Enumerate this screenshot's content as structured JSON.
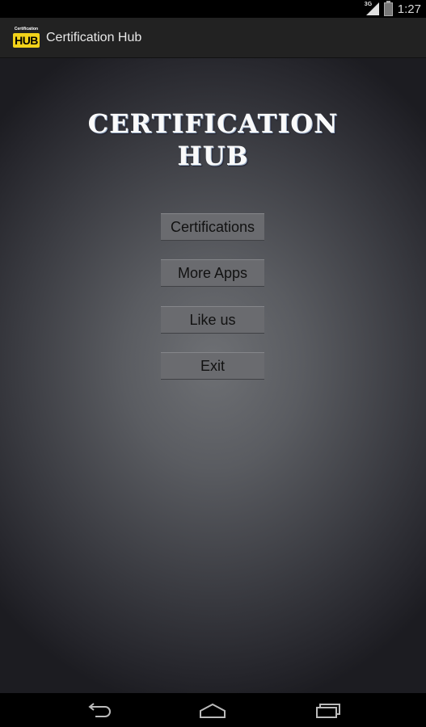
{
  "status_bar": {
    "network_label": "3G",
    "time": "1:27",
    "icons": [
      "signal-icon",
      "battery-icon"
    ]
  },
  "action_bar": {
    "icon_small_text": "Certification",
    "icon_big_text": "HUB",
    "title": "Certification Hub"
  },
  "main": {
    "logo_line1": "CERTIFICATION",
    "logo_line2": "HUB",
    "buttons": [
      {
        "label": "Certifications"
      },
      {
        "label": "More Apps"
      },
      {
        "label": "Like us"
      },
      {
        "label": "Exit"
      }
    ]
  },
  "nav_bar": {
    "icons": [
      "back-icon",
      "home-icon",
      "recent-apps-icon"
    ]
  },
  "colors": {
    "icon_yellow": "#f2d21a",
    "action_bar": "#222222",
    "button_bg": "#6a6b6f"
  }
}
